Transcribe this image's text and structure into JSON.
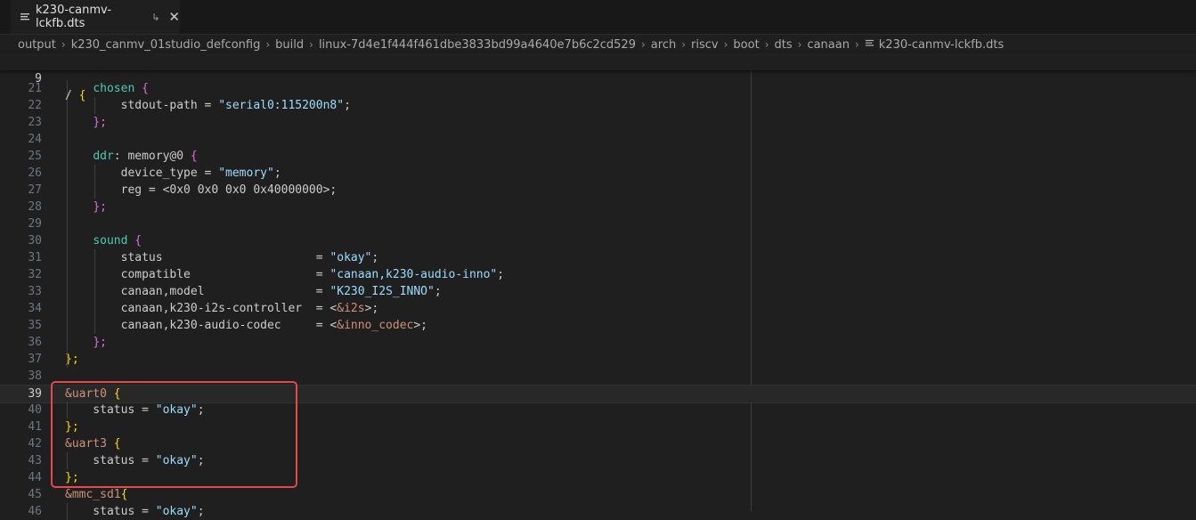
{
  "tab": {
    "title": "k230-canmv-lckfb.dts",
    "pin_glyph": "↳",
    "close_glyph": "✕"
  },
  "breadcrumb": [
    "output",
    "k230_canmv_01studio_defconfig",
    "build",
    "linux-7d4e1f444f461dbe3833bd99a4640e7b6c2cd529",
    "arch",
    "riscv",
    "boot",
    "dts",
    "canaan",
    "k230-canmv-lckfb.dts"
  ],
  "editor": {
    "sticky_line": {
      "num": "9",
      "text": "/ {"
    },
    "lines": [
      {
        "num": "21",
        "text": "    chosen {"
      },
      {
        "num": "22",
        "text": "        stdout-path = \"serial0:115200n8\";"
      },
      {
        "num": "23",
        "text": "    };"
      },
      {
        "num": "24",
        "text": ""
      },
      {
        "num": "25",
        "text": "    ddr: memory@0 {"
      },
      {
        "num": "26",
        "text": "        device_type = \"memory\";"
      },
      {
        "num": "27",
        "text": "        reg = <0x0 0x0 0x0 0x40000000>;"
      },
      {
        "num": "28",
        "text": "    };"
      },
      {
        "num": "29",
        "text": ""
      },
      {
        "num": "30",
        "text": "    sound {"
      },
      {
        "num": "31",
        "text": "        status                      = \"okay\";"
      },
      {
        "num": "32",
        "text": "        compatible                  = \"canaan,k230-audio-inno\";"
      },
      {
        "num": "33",
        "text": "        canaan,model                = \"K230_I2S_INNO\";"
      },
      {
        "num": "34",
        "text": "        canaan,k230-i2s-controller  = <&i2s>;"
      },
      {
        "num": "35",
        "text": "        canaan,k230-audio-codec     = <&inno_codec>;"
      },
      {
        "num": "36",
        "text": "    };"
      },
      {
        "num": "37",
        "text": "};"
      },
      {
        "num": "38",
        "text": ""
      },
      {
        "num": "39",
        "text": "&uart0 {"
      },
      {
        "num": "40",
        "text": "    status = \"okay\";"
      },
      {
        "num": "41",
        "text": "};"
      },
      {
        "num": "42",
        "text": "&uart3 {"
      },
      {
        "num": "43",
        "text": "    status = \"okay\";"
      },
      {
        "num": "44",
        "text": "};"
      },
      {
        "num": "45",
        "text": "&mmc_sd1{"
      },
      {
        "num": "46",
        "text": "    status = \"okay\";"
      }
    ],
    "active_line": "39"
  },
  "colors": {
    "highlight_box": "#e5484d",
    "background": "#1f1f1f"
  }
}
